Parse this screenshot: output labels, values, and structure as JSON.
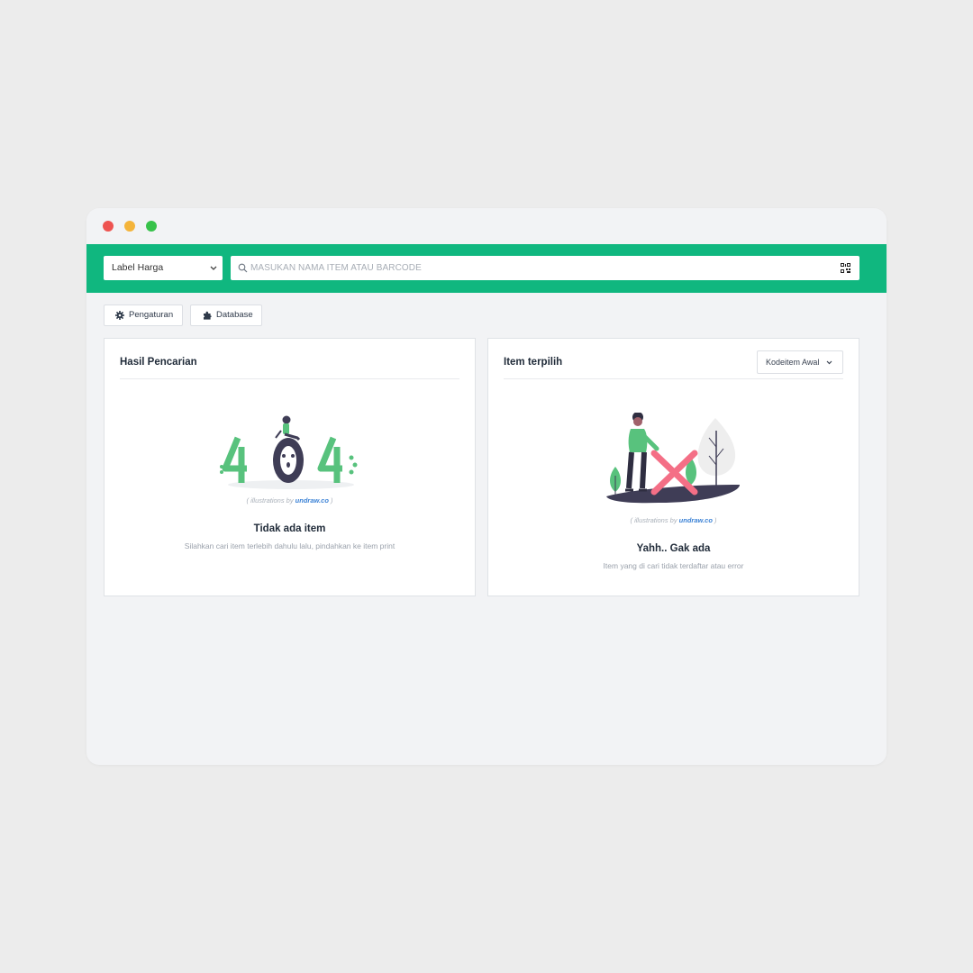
{
  "window": {
    "controls": [
      "close",
      "minimize",
      "maximize"
    ]
  },
  "colors": {
    "accent": "#10b77f",
    "close": "#ee5350",
    "minimize": "#f4b43a",
    "maximize": "#37c24a"
  },
  "toolbar": {
    "label_select": {
      "value": "Label Harga",
      "icon": "chevron-down-icon"
    },
    "search": {
      "placeholder": "MASUKAN NAMA ITEM ATAU BARCODE",
      "value": "",
      "icon": "search-icon",
      "scan_icon": "qr-code-icon"
    }
  },
  "actions": {
    "settings_label": "Pengaturan",
    "settings_icon": "gear-icon",
    "database_label": "Database",
    "database_icon": "puzzle-icon"
  },
  "panels": {
    "search_results": {
      "title": "Hasil Pencarian",
      "credit_prefix": "( illustrations by ",
      "credit_link": "undraw.co",
      "credit_suffix": " )",
      "empty_title": "Tidak ada item",
      "empty_desc": "Silahkan cari item terlebih dahulu lalu, pindahkan ke item print"
    },
    "selected_items": {
      "title": "Item terpilih",
      "sort_select": "Kodeitem Awal",
      "credit_prefix": "( illustrations by ",
      "credit_link": "undraw.co",
      "credit_suffix": " )",
      "empty_title": "Yahh.. Gak ada",
      "empty_desc": "Item yang di cari tidak terdaftar atau error"
    }
  }
}
